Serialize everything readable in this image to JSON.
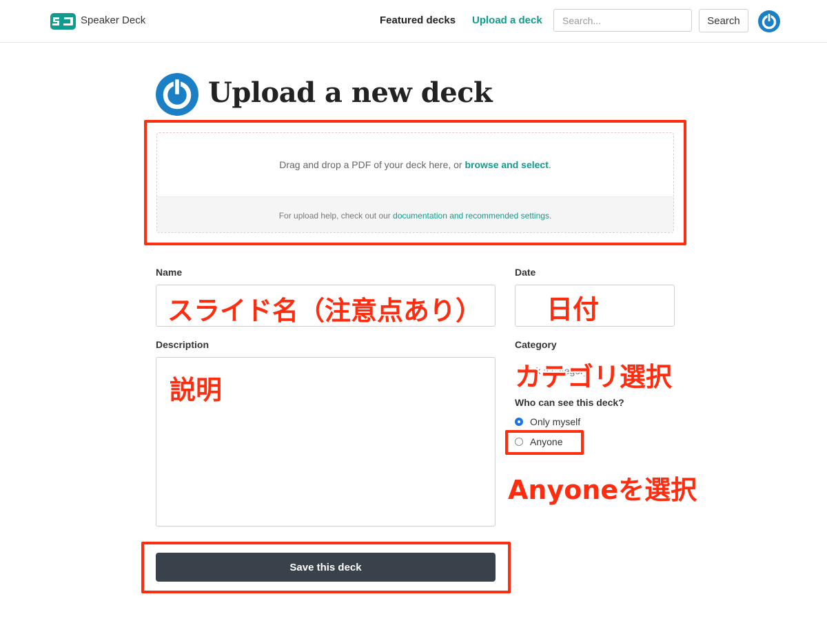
{
  "header": {
    "brand": "Speaker Deck",
    "nav_featured": "Featured decks",
    "nav_upload": "Upload a deck",
    "search_placeholder": "Search...",
    "search_button": "Search"
  },
  "page": {
    "title": "Upload a new deck"
  },
  "upload": {
    "drop_text": "Drag and drop a PDF of your deck here, or ",
    "drop_link": "browse and select",
    "drop_end": ".",
    "help_text": "For upload help, check out our ",
    "help_link": "documentation and recommended settings",
    "help_end": "."
  },
  "form": {
    "name_label": "Name",
    "date_label": "Date",
    "description_label": "Description",
    "category_label": "Category",
    "category_value": "Pick a category",
    "visibility_label": "Who can see this deck?",
    "option_only_me": "Only myself",
    "option_anyone": "Anyone",
    "save_button": "Save this deck"
  },
  "annotations": {
    "name": "スライド名（注意点あり）",
    "date": "日付",
    "description": "説明",
    "category": "カテゴリ選択",
    "anyone": "Anyoneを選択"
  },
  "colors": {
    "accent": "#0f9b8e",
    "annotation": "#ff2d10",
    "save_button": "#39424a",
    "avatar": "#1a7fc4"
  }
}
